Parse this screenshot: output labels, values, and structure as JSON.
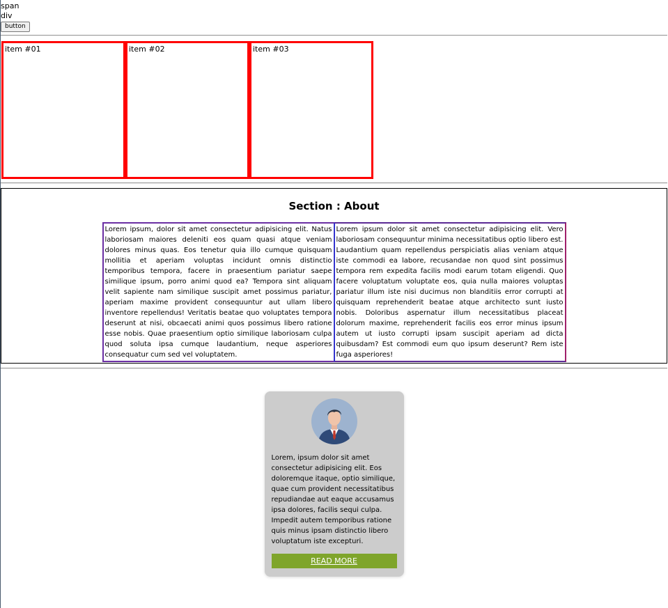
{
  "top": {
    "span_text": "span",
    "div_text": "div",
    "button_label": "button"
  },
  "items": [
    {
      "label": "item #01"
    },
    {
      "label": "item #02"
    },
    {
      "label": "item #03"
    }
  ],
  "about": {
    "title": "Section : About",
    "col1": "Lorem ipsum, dolor sit amet consectetur adipisicing elit. Natus laboriosam maiores deleniti eos quam quasi atque veniam dolores minus quas. Eos tenetur quia illo cumque quisquam mollitia et aperiam voluptas incidunt omnis distinctio temporibus tempora, facere in praesentium pariatur saepe similique ipsum, porro animi quod ea? Tempora sint aliquam velit sapiente nam similique suscipit amet possimus pariatur, aperiam maxime provident consequuntur aut ullam libero inventore repellendus! Veritatis beatae quo voluptates tempora deserunt at nisi, obcaecati animi quos possimus libero ratione esse nobis. Quae praesentium optio similique laboriosam culpa quod soluta ipsa cumque laudantium, neque asperiores consequatur cum sed vel voluptatem.",
    "col2": "Lorem ipsum dolor sit amet consectetur adipisicing elit. Vero laboriosam consequuntur minima necessitatibus optio libero est. Laudantium quam repellendus perspiciatis alias veniam atque iste commodi ea labore, recusandae non quod sint possimus tempora rem expedita facilis modi earum totam eligendi. Quo facere voluptatum voluptate eos, quia nulla maiores voluptas pariatur illum iste nisi ducimus non blanditiis error corrupti at quisquam reprehenderit beatae atque architecto sunt iusto nobis. Doloribus aspernatur illum necessitatibus placeat dolorum maxime, reprehenderit facilis eos error minus ipsum autem ut iusto corrupti ipsam suscipit aperiam ad dicta quibusdam? Est commodi eum quo ipsum deserunt? Rem iste fuga asperiores!"
  },
  "card": {
    "avatar_icon": "person-avatar-icon",
    "text": "Lorem, ipsum dolor sit amet consectetur adipisicing elit. Eos doloremque itaque, optio similique, quae cum provident necessitatibus repudiandae aut eaque accusamus ipsa dolores, facilis sequi culpa. Impedit autem temporibus ratione quis minus ipsam distinctio libero voluptatum iste excepturi.",
    "read_more_label": "READ MORE",
    "colors": {
      "card_bg": "#cccccc",
      "button_bg": "#7fa52b"
    }
  },
  "colors": {
    "item_border": "#ff0000"
  }
}
